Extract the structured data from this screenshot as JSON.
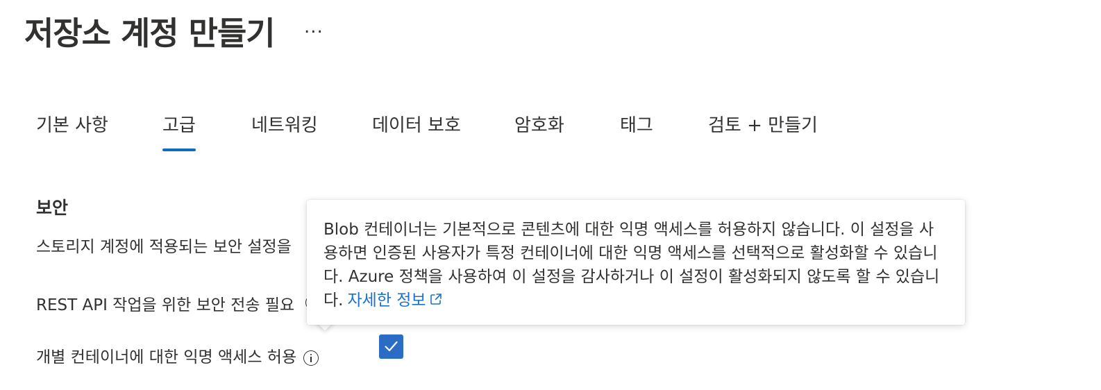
{
  "header": {
    "title": "저장소 계정 만들기",
    "more_label": "..."
  },
  "tabs": [
    {
      "label": "기본 사항",
      "active": false
    },
    {
      "label": "고급",
      "active": true
    },
    {
      "label": "네트워킹",
      "active": false
    },
    {
      "label": "데이터 보호",
      "active": false
    },
    {
      "label": "암호화",
      "active": false
    },
    {
      "label": "태그",
      "active": false
    },
    {
      "label": "검토 + 만들기",
      "active": false
    }
  ],
  "section": {
    "title": "보안",
    "description": "스토리지 계정에 적용되는 보안 설정을"
  },
  "rows": {
    "secure_transfer_label": "REST API 작업을 위한 보안 전송 필요",
    "anonymous_access_label": "개별 컨테이너에 대한 익명 액세스 허용",
    "anonymous_access_checked": true
  },
  "callout": {
    "text": "Blob 컨테이너는 기본적으로 콘텐츠에 대한 익명 액세스를 허용하지 않습니다. 이 설정을 사용하면 인증된 사용자가 특정 컨테이너에 대한 익명 액세스를 선택적으로 활성화할 수 있습니다. Azure 정책을 사용하여 이 설정을 감사하거나 이 설정이 활성화되지 않도록 할 수 있습니다.",
    "link_text": "자세한 정보"
  },
  "colors": {
    "accent": "#0f6cbd",
    "checkbox": "#2b6cc4",
    "link": "#1a73c9",
    "text": "#323130"
  }
}
